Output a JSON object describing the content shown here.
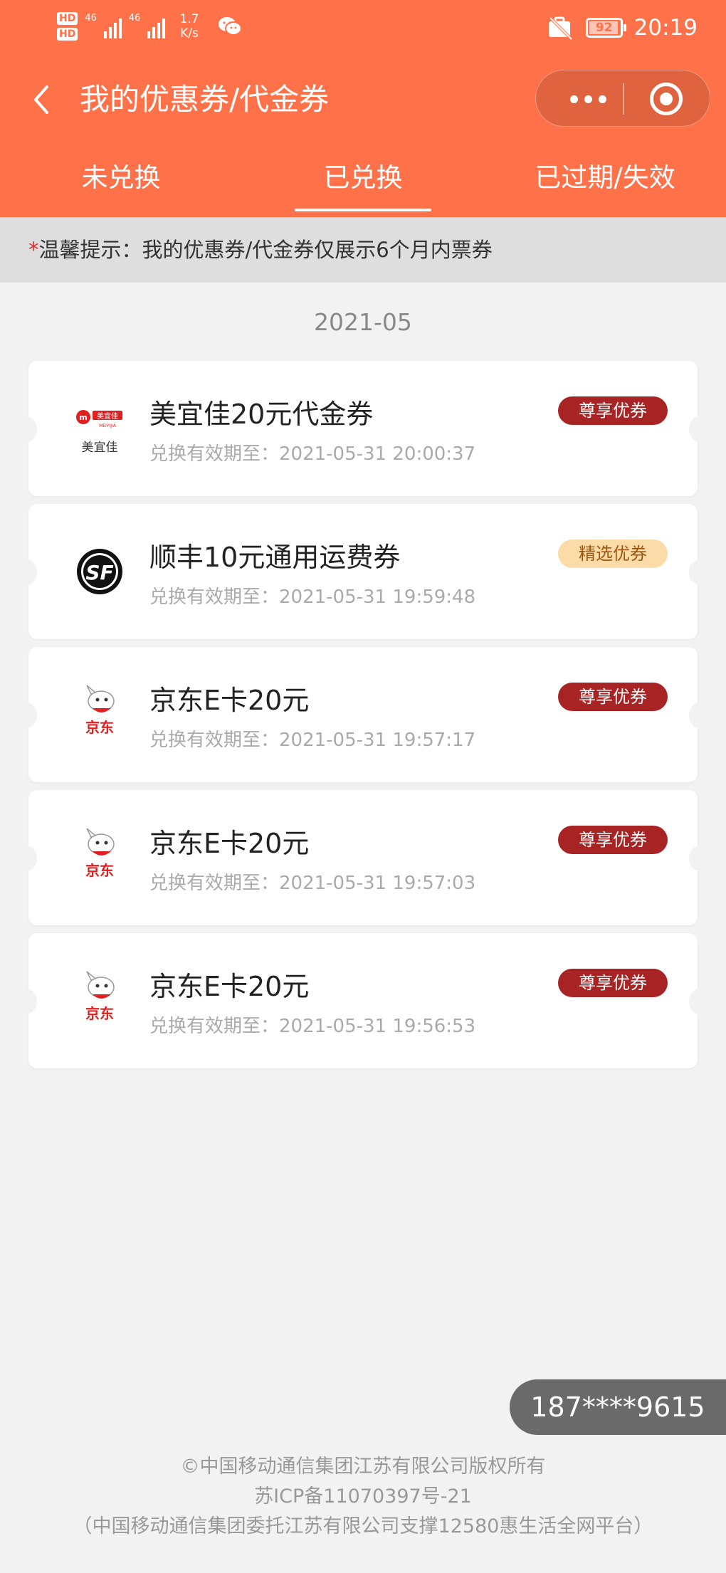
{
  "status_bar": {
    "hd1": "HD",
    "hd2": "HD",
    "net1": "46",
    "net2": "46",
    "speed_value": "1.7",
    "speed_unit": "K/s",
    "battery": "92",
    "time": "20:19"
  },
  "nav": {
    "title": "我的优惠券/代金券"
  },
  "tabs": [
    {
      "label": "未兑换",
      "active": false
    },
    {
      "label": "已兑换",
      "active": true
    },
    {
      "label": "已过期/失效",
      "active": false
    }
  ],
  "notice": {
    "star": "*",
    "text": "温馨提示：我的优惠券/代金券仅展示6个月内票券"
  },
  "month": "2021-05",
  "coupons": [
    {
      "title": "美宜佳20元代金券",
      "date": "兑换有效期至：2021-05-31 20:00:37",
      "badge": "尊享优券",
      "badge_type": "premium",
      "logo": "meiyijia-logo",
      "logo_text": "美宜佳",
      "logo_sub": "MEIYIJIA"
    },
    {
      "title": "顺丰10元通用运费券",
      "date": "兑换有效期至：2021-05-31 19:59:48",
      "badge": "精选优券",
      "badge_type": "select",
      "logo": "sf-logo",
      "logo_text": "SF"
    },
    {
      "title": "京东E卡20元",
      "date": "兑换有效期至：2021-05-31 19:57:17",
      "badge": "尊享优券",
      "badge_type": "premium",
      "logo": "jd-logo",
      "logo_text": "京东"
    },
    {
      "title": "京东E卡20元",
      "date": "兑换有效期至：2021-05-31 19:57:03",
      "badge": "尊享优券",
      "badge_type": "premium",
      "logo": "jd-logo",
      "logo_text": "京东"
    },
    {
      "title": "京东E卡20元",
      "date": "兑换有效期至：2021-05-31 19:56:53",
      "badge": "尊享优券",
      "badge_type": "premium",
      "logo": "jd-logo",
      "logo_text": "京东"
    }
  ],
  "phone": "187****9615",
  "footer": {
    "line1": "©中国移动通信集团江苏有限公司版权所有",
    "line2": "苏ICP备11070397号-21",
    "line3": "（中国移动通信集团委托江苏有限公司支撑12580惠生活全网平台）"
  },
  "colors": {
    "header": "#ff7149",
    "premium_badge": "#a82323",
    "select_badge": "#fbdca8"
  }
}
